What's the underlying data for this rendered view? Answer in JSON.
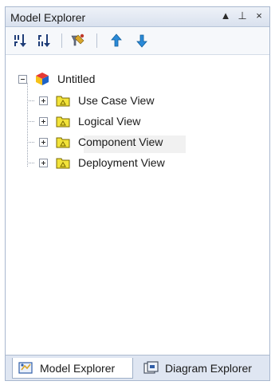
{
  "panel": {
    "title": "Model Explorer",
    "title_buttons": {
      "dropdown": "▲",
      "pin": "⊥",
      "close": "×"
    }
  },
  "toolbar": {
    "icons": [
      "sort-ascending-icon",
      "sort-descending-icon",
      "filter-icon",
      "move-up-icon",
      "move-down-icon"
    ]
  },
  "tree": {
    "root": {
      "label": "Untitled",
      "icon": "model-cube-icon",
      "expanded": true
    },
    "children": [
      {
        "label": "Use Case View",
        "icon": "package-folder-icon",
        "expanded": false
      },
      {
        "label": "Logical View",
        "icon": "package-folder-icon",
        "expanded": false
      },
      {
        "label": "Component View",
        "icon": "package-folder-icon",
        "expanded": false,
        "selected": true
      },
      {
        "label": "Deployment View",
        "icon": "package-folder-icon",
        "expanded": false
      }
    ]
  },
  "tabs": [
    {
      "label": "Model Explorer",
      "active": true,
      "icon": "model-explorer-icon"
    },
    {
      "label": "Diagram Explorer",
      "active": false,
      "icon": "diagram-explorer-icon"
    }
  ],
  "colors": {
    "titlebar": "#d9e1ee",
    "folder": "#f2e33a",
    "folder_border": "#7a6a00",
    "move_arrows": "#2a8ad8",
    "tab_strip": "#dfe6f2"
  }
}
